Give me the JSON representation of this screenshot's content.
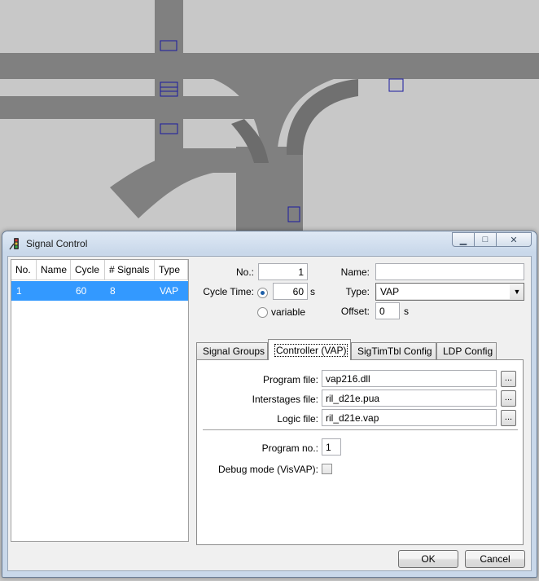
{
  "window": {
    "title": "Signal Control"
  },
  "controllers": {
    "columns": [
      "No.",
      "Name",
      "Cycle",
      "# Signals",
      "Type"
    ],
    "rows": [
      {
        "no": "1",
        "name": "",
        "cycle": "60",
        "signals": "8",
        "type": "VAP"
      }
    ]
  },
  "form": {
    "no_label": "No.:",
    "no_value": "1",
    "name_label": "Name:",
    "name_value": "",
    "cycle_label": "Cycle Time:",
    "cycle_value": "60",
    "cycle_unit": "s",
    "variable_label": "variable",
    "type_label": "Type:",
    "type_value": "VAP",
    "offset_label": "Offset:",
    "offset_value": "0",
    "offset_unit": "s"
  },
  "tabs": [
    {
      "label": "Signal Groups"
    },
    {
      "label": "Controller (VAP)"
    },
    {
      "label": "SigTimTbl Config"
    },
    {
      "label": "LDP Config"
    }
  ],
  "vap": {
    "program_file_label": "Program file:",
    "program_file": "vap216.dll",
    "interstages_label": "Interstages file:",
    "interstages_file": "ril_d21e.pua",
    "logic_label": "Logic file:",
    "logic_file": "ril_d21e.vap",
    "browse": "...",
    "program_no_label": "Program no.:",
    "program_no": "1",
    "debug_label": "Debug mode (VisVAP):"
  },
  "buttons": {
    "ok": "OK",
    "cancel": "Cancel"
  },
  "window_buttons": {
    "minimize": "▁",
    "maximize": "□",
    "close": "✕"
  },
  "colors": {
    "road": "#808080",
    "background": "#c8c8c8",
    "detector": "#1a1aa0",
    "selection": "#3399ff"
  },
  "icons": [
    "traffic-light-icon",
    "minimize-icon",
    "maximize-icon",
    "close-icon",
    "dropdown-arrow-icon"
  ]
}
